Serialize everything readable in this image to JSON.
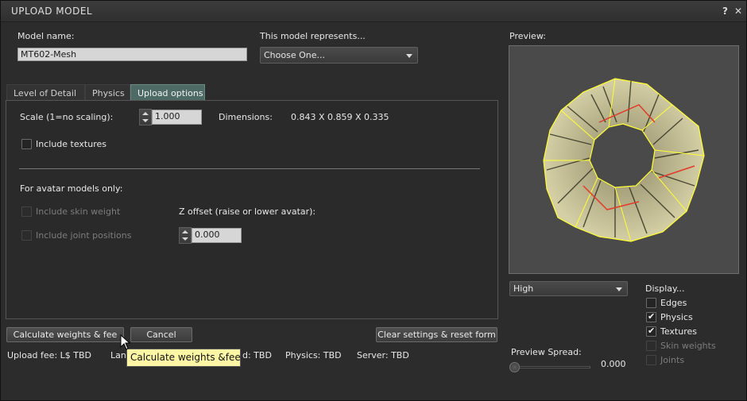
{
  "window": {
    "title": "UPLOAD MODEL",
    "help_glyph": "?",
    "close_glyph": "✕"
  },
  "model_name": {
    "label": "Model name:",
    "value": "MT602-Mesh"
  },
  "represents": {
    "label": "This model represents...",
    "selected": "Choose One..."
  },
  "tabs": [
    {
      "label": "Level of Detail",
      "active": false
    },
    {
      "label": "Physics",
      "active": false
    },
    {
      "label": "Upload options",
      "active": true
    }
  ],
  "upload_options": {
    "scale_label": "Scale (1=no scaling):",
    "scale_value": "1.000",
    "dimensions_label": "Dimensions:",
    "dimensions_value": "0.843 X 0.859 X 0.335",
    "include_textures": "Include textures",
    "avatar_heading": "For avatar models only:",
    "include_skin_weight": "Include skin weight",
    "include_joint_positions": "Include joint positions",
    "z_offset_label": "Z offset (raise or lower avatar):",
    "z_offset_value": "0.000"
  },
  "buttons": {
    "calculate": "Calculate weights & fee",
    "cancel": "Cancel",
    "clear": "Clear settings & reset form"
  },
  "fees": {
    "upload_fee": "Upload fee: L$ TBD",
    "land_partial": "Lan",
    "download_partial": "d: TBD",
    "physics": "Physics: TBD",
    "server": "Server: TBD"
  },
  "tooltip": "Calculate weights &fee",
  "preview": {
    "label": "Preview:",
    "quality": "High",
    "spread_label": "Preview Spread:",
    "spread_value": "0.000",
    "spread_fraction": 0.0
  },
  "display": {
    "label": "Display...",
    "edges": {
      "label": "Edges",
      "checked": false
    },
    "physics": {
      "label": "Physics",
      "checked": true
    },
    "textures": {
      "label": "Textures",
      "checked": true
    },
    "skin_weights": {
      "label": "Skin weights",
      "checked": false,
      "disabled": true
    },
    "joints": {
      "label": "Joints",
      "checked": false,
      "disabled": true
    }
  },
  "icons": [
    "help-icon",
    "close-icon",
    "dropdown-arrow-icon",
    "spinner-icon",
    "mouse-cursor-icon"
  ]
}
